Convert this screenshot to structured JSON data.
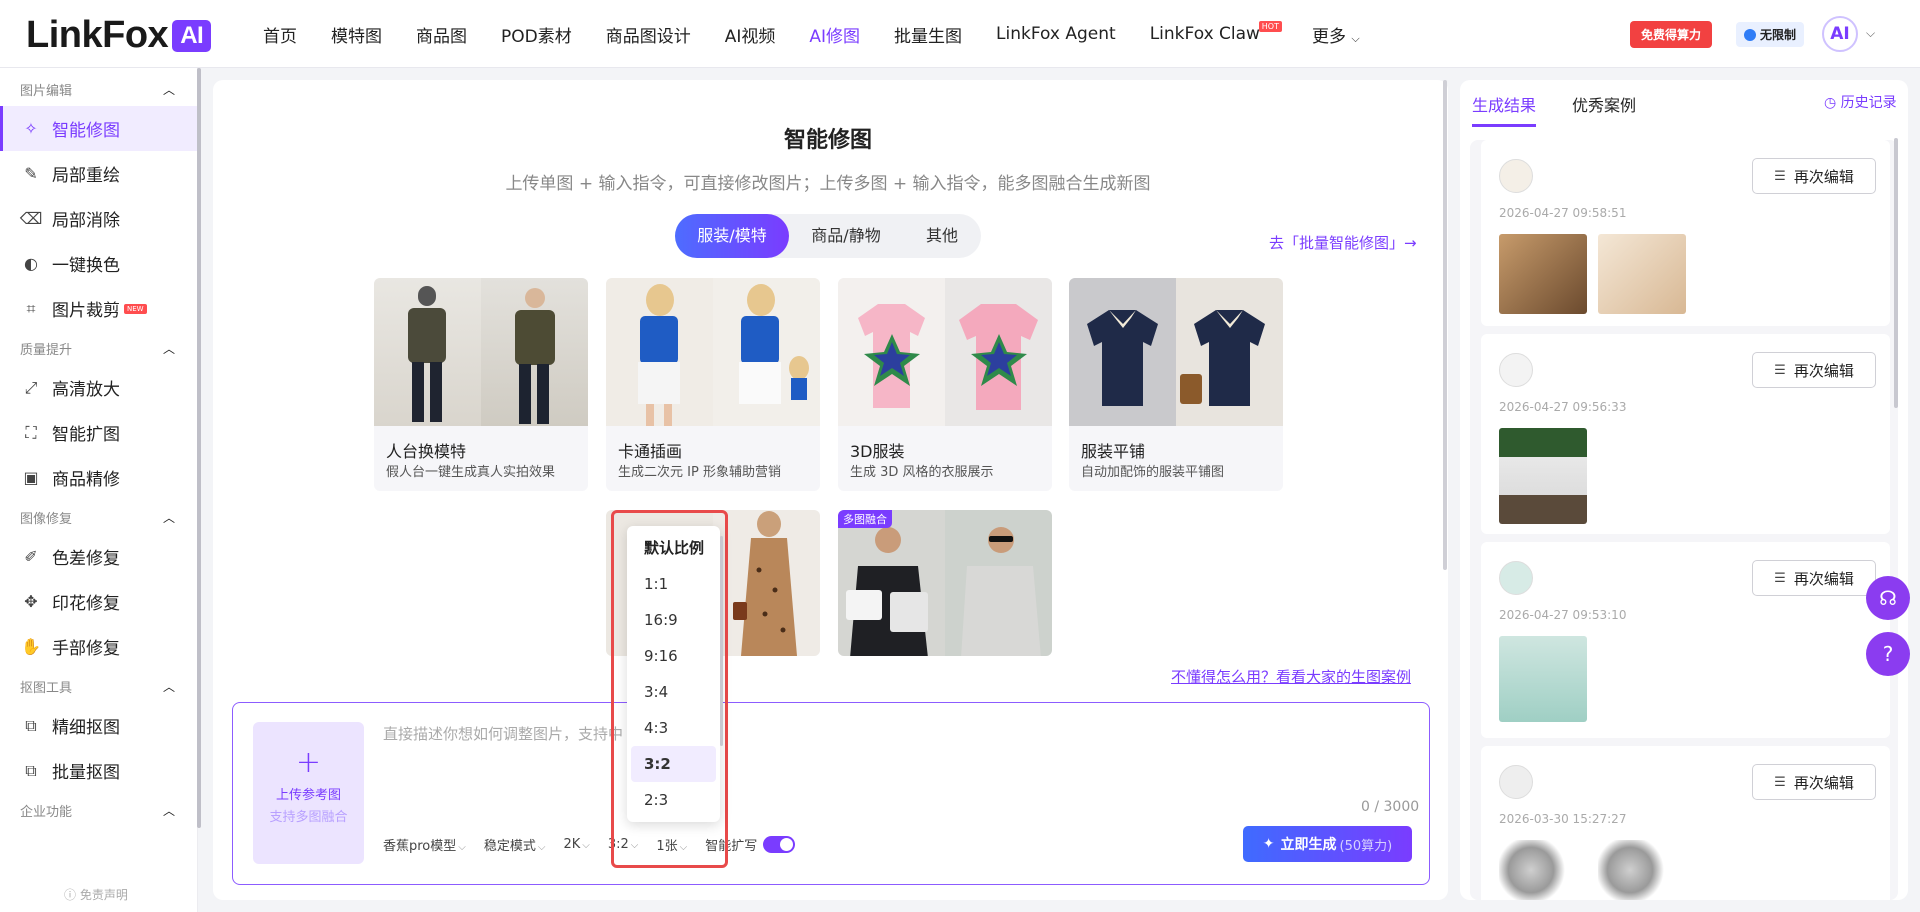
{
  "header": {
    "logo_text": "LinkFox",
    "logo_badge": "AI",
    "nav": [
      "首页",
      "模特图",
      "商品图",
      "POD素材",
      "商品图设计",
      "AI视频",
      "AI修图",
      "批量生图",
      "LinkFox Agent",
      "LinkFox Claw",
      "更多"
    ],
    "nav_active": "AI修图",
    "hot_badge": "HOT",
    "free_btn": "免费得算力",
    "unlimited_btn": "无限制",
    "avatar_text": "AI"
  },
  "sidebar": {
    "sections": [
      {
        "title": "图片编辑",
        "items": [
          "智能修图",
          "局部重绘",
          "局部消除",
          "一键换色",
          "图片裁剪"
        ]
      },
      {
        "title": "质量提升",
        "items": [
          "高清放大",
          "智能扩图",
          "商品精修"
        ]
      },
      {
        "title": "图像修复",
        "items": [
          "色差修复",
          "印花修复",
          "手部修复"
        ]
      },
      {
        "title": "抠图工具",
        "items": [
          "精细抠图",
          "批量抠图"
        ]
      },
      {
        "title": "企业功能",
        "items": []
      }
    ],
    "active_item": "智能修图",
    "new_badge": "NEW",
    "disclaimer": "ⓘ 免责声明"
  },
  "main": {
    "title": "智能修图",
    "subtitle": "上传单图 + 输入指令，可直接修改图片；上传多图 + 输入指令，能多图融合生成新图",
    "tabs": [
      "服装/模特",
      "商品/静物",
      "其他"
    ],
    "active_tab": "服装/模特",
    "batch_link": "去「批量智能修图」→",
    "cards": [
      {
        "title": "人台换模特",
        "desc": "假人台一键生成真人实拍效果"
      },
      {
        "title": "卡通插画",
        "desc": "生成二次元 IP 形象辅助营销"
      },
      {
        "title": "3D服装",
        "desc": "生成 3D 风格的衣服展示"
      },
      {
        "title": "服装平铺",
        "desc": "自动加配饰的服装平铺图"
      }
    ],
    "merge_badge": "多图融合",
    "help_link": "不懂得怎么用？看看大家的生图案例"
  },
  "composer": {
    "upload_line1": "上传参考图",
    "upload_line2": "支持多图融合",
    "prompt_placeholder": "直接描述你想如何调整图片，支持中",
    "counter": "0 / 3000",
    "options": {
      "model": "香蕉pro模型",
      "mode": "稳定模式",
      "resolution": "2K",
      "ratio": "3:2",
      "count": "1张",
      "smart_expand": "智能扩写"
    },
    "smart_expand_on": true,
    "generate_label": "立即生成",
    "generate_cost": "(50算力)"
  },
  "ratio_dropdown": {
    "items": [
      "默认比例",
      "1:1",
      "16:9",
      "9:16",
      "3:4",
      "4:3",
      "3:2",
      "2:3"
    ],
    "selected": "3:2"
  },
  "results": {
    "tabs": [
      "生成结果",
      "优秀案例"
    ],
    "active_tab": "生成结果",
    "history": "历史记录",
    "edit_label": "再次编辑",
    "items": [
      {
        "time": "2026-04-27 09:58:51"
      },
      {
        "time": "2026-04-27 09:56:33"
      },
      {
        "time": "2026-04-27 09:53:10"
      },
      {
        "time": "2026-03-30 15:27:27"
      }
    ]
  },
  "colors": {
    "accent": "#7a3cff",
    "hot": "#ff4d4f",
    "free_btn": "#f24141",
    "highlight_frame": "#e84a4a"
  }
}
